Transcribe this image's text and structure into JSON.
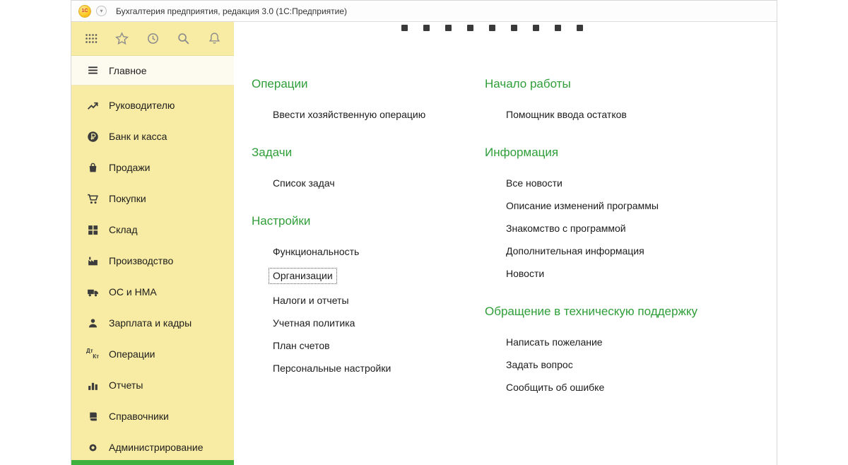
{
  "window": {
    "logo_text": "1С",
    "title": "Бухгалтерия предприятия, редакция 3.0  (1С:Предприятие)"
  },
  "sidebar": {
    "toolbar": [
      {
        "name": "menu",
        "icon": "grid-dots-icon"
      },
      {
        "name": "favorites",
        "icon": "star-icon"
      },
      {
        "name": "history",
        "icon": "history-clock-icon"
      },
      {
        "name": "search",
        "icon": "magnifier-icon"
      },
      {
        "name": "notifications",
        "icon": "bell-icon"
      }
    ],
    "active_item": "Главное",
    "items": [
      {
        "label": "Руководителю",
        "icon": "trend-icon"
      },
      {
        "label": "Банк и касса",
        "icon": "ruble-circle-icon"
      },
      {
        "label": "Продажи",
        "icon": "bag-icon"
      },
      {
        "label": "Покупки",
        "icon": "cart-icon"
      },
      {
        "label": "Склад",
        "icon": "blocks-icon"
      },
      {
        "label": "Производство",
        "icon": "factory-icon"
      },
      {
        "label": "ОС и НМА",
        "icon": "truck-icon"
      },
      {
        "label": "Зарплата и кадры",
        "icon": "person-icon"
      },
      {
        "label": "Операции",
        "icon": "dt-kt-icon",
        "icon_text_top": "Дт",
        "icon_text_bottom": "Кт"
      },
      {
        "label": "Отчеты",
        "icon": "bar-chart-icon"
      },
      {
        "label": "Справочники",
        "icon": "book-icon"
      },
      {
        "label": "Администрирование",
        "icon": "gear-icon"
      }
    ]
  },
  "content": {
    "focused_link": "Организации",
    "col1": [
      {
        "title": "Операции",
        "links": [
          "Ввести хозяйственную операцию"
        ]
      },
      {
        "title": "Задачи",
        "links": [
          "Список задач"
        ]
      },
      {
        "title": "Настройки",
        "links": [
          "Функциональность",
          "Организации",
          "Налоги и отчеты",
          "Учетная политика",
          "План счетов",
          "Персональные настройки"
        ]
      }
    ],
    "col2": [
      {
        "title": "Начало работы",
        "links": [
          "Помощник ввода остатков"
        ]
      },
      {
        "title": "Информация",
        "links": [
          "Все новости",
          "Описание изменений программы",
          "Знакомство с программой",
          "Дополнительная информация",
          "Новости"
        ]
      },
      {
        "title": "Обращение в техническую поддержку",
        "links": [
          "Написать пожелание",
          "Задать вопрос",
          "Сообщить об ошибке"
        ]
      }
    ]
  },
  "colors": {
    "sidebar_bg": "#f8eba3",
    "active_item_bg": "#fdfaf0",
    "section_title_green": "#2f9e39",
    "green_strip": "#3eb13e",
    "logo_orange": "#ffc821",
    "logo_text_red": "#d63a2e"
  }
}
